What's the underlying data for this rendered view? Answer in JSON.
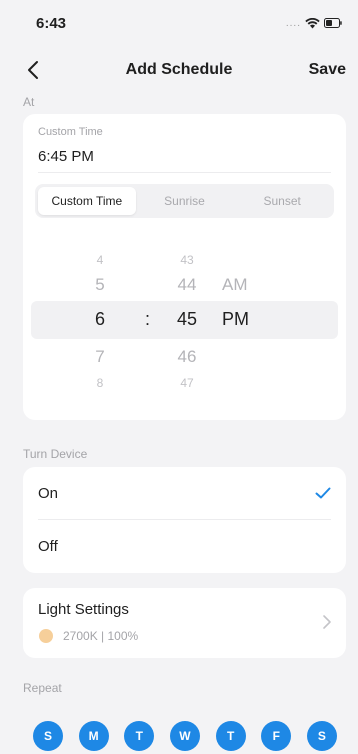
{
  "status_bar": {
    "time": "6:43",
    "signal": "...."
  },
  "nav": {
    "title": "Add Schedule",
    "save_label": "Save"
  },
  "at_section": {
    "label": "At",
    "custom_time_label": "Custom Time",
    "custom_time_value": "6:45 PM",
    "tabs": [
      "Custom Time",
      "Sunrise",
      "Sunset"
    ],
    "active_tab": "Custom Time",
    "picker": {
      "hours": [
        "",
        "4",
        "5",
        "6",
        "7",
        "8",
        ""
      ],
      "minutes": [
        "",
        "43",
        "44",
        "45",
        "46",
        "47",
        ""
      ],
      "ampm": [
        "AM",
        "PM"
      ],
      "separator": ":"
    }
  },
  "turn_device": {
    "label": "Turn Device",
    "options": [
      "On",
      "Off"
    ],
    "selected": "On"
  },
  "light_settings": {
    "title": "Light Settings",
    "value": "2700K | 100%",
    "swatch_color": "#f6cf9a"
  },
  "repeat": {
    "label": "Repeat",
    "days": [
      "S",
      "M",
      "T",
      "W",
      "T",
      "F",
      "S"
    ]
  },
  "colors": {
    "accent": "#1e88e5",
    "background": "#f3f3f5"
  }
}
